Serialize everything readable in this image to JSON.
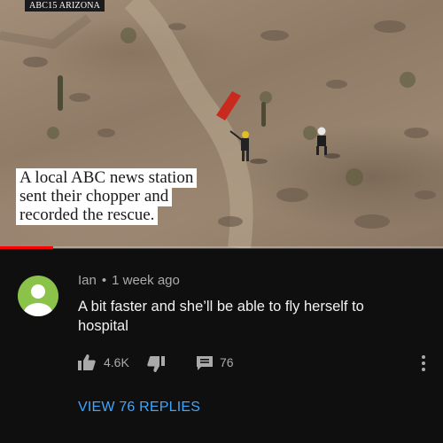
{
  "video": {
    "watermark": "ABC15 ARIZONA",
    "caption_lines": [
      "A local ABC news station",
      "sent their chopper and",
      "recorded the rescue."
    ]
  },
  "comment": {
    "author": "Ian",
    "separator": "•",
    "time_ago": "1 week ago",
    "text": "A bit faster and she’ll be able to fly herself to hospital",
    "likes": "4.6K",
    "reply_count": "76",
    "view_replies_label": "VIEW 76 REPLIES"
  },
  "icons": {
    "like": "thumbs-up-icon",
    "dislike": "thumbs-down-icon",
    "replies": "comment-bubble-icon",
    "more": "more-vertical-icon"
  },
  "colors": {
    "background": "#0f0f0f",
    "avatar": "#8bc34a",
    "link": "#3ea6ff",
    "progress": "#ff0000"
  }
}
